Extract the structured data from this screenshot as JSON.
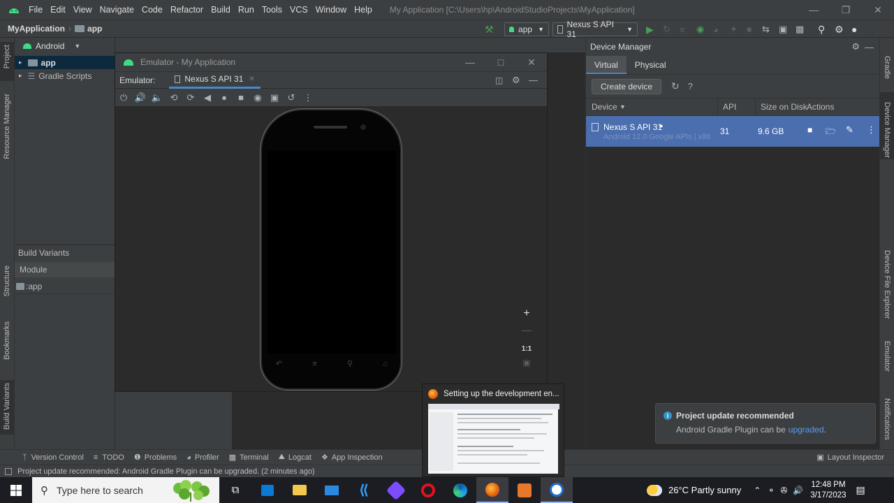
{
  "titlebar": {
    "menu": [
      "File",
      "Edit",
      "View",
      "Navigate",
      "Code",
      "Refactor",
      "Build",
      "Run",
      "Tools",
      "VCS",
      "Window",
      "Help"
    ],
    "window_title": "My Application [C:\\Users\\hp\\AndroidStudioProjects\\MyApplication]"
  },
  "navbar": {
    "project": "MyApplication",
    "module": "app",
    "run_config": "app",
    "device": "Nexus S API 31"
  },
  "left_stripe": {
    "project": "Project",
    "resource_manager": "Resource Manager",
    "structure": "Structure",
    "bookmarks": "Bookmarks",
    "build_variants": "Build Variants"
  },
  "project_panel": {
    "view_mode": "Android",
    "items": [
      {
        "label": "app"
      },
      {
        "label": "Gradle Scripts"
      }
    ],
    "build_variants": {
      "title": "Build Variants",
      "column_header": "Module",
      "row": ":app"
    }
  },
  "emulator": {
    "title": "Emulator - My Application",
    "tab_label": "Emulator:",
    "tab_device": "Nexus S API 31",
    "zoom_ratio": "1:1"
  },
  "device_manager": {
    "title": "Device Manager",
    "tabs": [
      "Virtual",
      "Physical"
    ],
    "create_button": "Create device",
    "columns": {
      "device": "Device",
      "api": "API",
      "size": "Size on Disk",
      "actions": "Actions"
    },
    "devices": [
      {
        "name": "Nexus S API 31",
        "subtitle": "Android 12.0 Google APIs | x86",
        "api": "31",
        "size": "9.6 GB"
      }
    ]
  },
  "right_stripe": {
    "gradle": "Gradle",
    "device_manager": "Device Manager",
    "device_file_explorer": "Device File Explorer",
    "emulator": "Emulator",
    "notifications": "Notifications"
  },
  "bottom_tools": [
    "Version Control",
    "TODO",
    "Problems",
    "Profiler",
    "Terminal",
    "Logcat",
    "App Inspection"
  ],
  "bottom_right_tool": "Layout Inspector",
  "status": "Project update recommended: Android Gradle Plugin can be upgraded. (2 minutes ago)",
  "notification": {
    "title": "Project update recommended",
    "body": "Android Gradle Plugin can be",
    "link": "upgraded",
    "tail": "."
  },
  "preview": {
    "title": "Setting up the development en..."
  },
  "taskbar": {
    "search_placeholder": "Type here to search",
    "weather": "26°C  Partly sunny",
    "time": "12:48 PM",
    "date": "3/17/2023"
  },
  "colors": {
    "accent_select": "#4b6eaf",
    "link": "#589df6",
    "info": "#3592c4"
  }
}
